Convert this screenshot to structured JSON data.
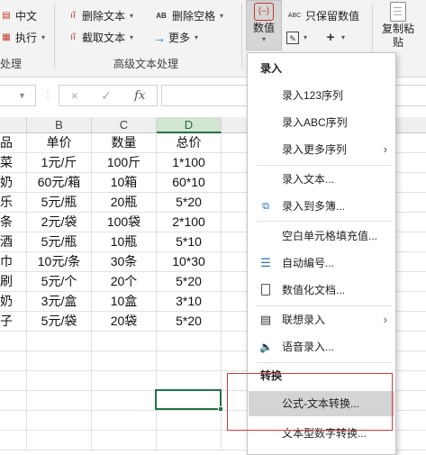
{
  "ribbon": {
    "row1": [
      {
        "label": "中文",
        "icon": "chinese-icon"
      },
      {
        "label": "删除文本",
        "icon": "delete-text-icon"
      },
      {
        "label": "删除空格",
        "icon": "delete-space-icon",
        "prefix": "AB"
      },
      {
        "label": "只保留数值",
        "icon": "keep-numbers-icon",
        "prefix": "ABC"
      }
    ],
    "row2": [
      {
        "label": "执行",
        "icon": "execute-icon"
      },
      {
        "label": "截取文本",
        "icon": "extract-text-icon"
      },
      {
        "label": "更多",
        "icon": "more-arrow-icon"
      }
    ],
    "row3_icons": [
      "edit-format-icon",
      "plus-icon"
    ],
    "numeric_button": {
      "label": "数值"
    },
    "copy_button": {
      "label_line1": "复制粘",
      "label_line2": "贴"
    },
    "groups": {
      "left": "处理",
      "advanced": "高级文本处理"
    }
  },
  "formula_bar": {
    "fx_label": "fx",
    "cancel_symbol": "×",
    "confirm_symbol": "✓",
    "value": ""
  },
  "grid": {
    "columns": [
      "B",
      "C",
      "D"
    ],
    "headers": {
      "a": "品",
      "b": "单价",
      "c": "数量",
      "d": "总价"
    },
    "rows": [
      {
        "a": "菜",
        "b": "1元/斤",
        "c": "100斤",
        "d": "1*100"
      },
      {
        "a": "奶",
        "b": "60元/箱",
        "c": "10箱",
        "d": "60*10"
      },
      {
        "a": "乐",
        "b": "5元/瓶",
        "c": "20瓶",
        "d": "5*20"
      },
      {
        "a": "条",
        "b": "2元/袋",
        "c": "100袋",
        "d": "2*100"
      },
      {
        "a": "酒",
        "b": "5元/瓶",
        "c": "10瓶",
        "d": "5*10"
      },
      {
        "a": "巾",
        "b": "10元/条",
        "c": "30条",
        "d": "10*30"
      },
      {
        "a": "刷",
        "b": "5元/个",
        "c": "20个",
        "d": "5*20"
      },
      {
        "a": "奶",
        "b": "3元/盒",
        "c": "10盒",
        "d": "3*10"
      },
      {
        "a": "子",
        "b": "5元/袋",
        "c": "20袋",
        "d": "5*20"
      }
    ]
  },
  "menu": {
    "section_input": "录入",
    "section_convert": "转换",
    "items": [
      {
        "label": "录入123序列",
        "icon": "",
        "arrow": ""
      },
      {
        "label": "录入ABC序列",
        "icon": "",
        "arrow": ""
      },
      {
        "label": "录入更多序列",
        "icon": "",
        "arrow": "›"
      },
      {
        "label": "录入文本...",
        "icon": "",
        "arrow": ""
      },
      {
        "label": "录入到多簿...",
        "icon": "copy-sheets-icon",
        "arrow": ""
      },
      {
        "label": "空白单元格填充值...",
        "icon": "",
        "arrow": ""
      },
      {
        "label": "自动编号...",
        "icon": "numbered-list-icon",
        "arrow": ""
      },
      {
        "label": "数值化文档...",
        "icon": "document-icon",
        "arrow": ""
      },
      {
        "label": "联想录入",
        "icon": "table-icon",
        "arrow": "›"
      },
      {
        "label": "语音录入...",
        "icon": "speaker-icon",
        "arrow": ""
      },
      {
        "label": "公式-文本转换...",
        "icon": "",
        "arrow": ""
      },
      {
        "label": "文本型数字转换...",
        "icon": "",
        "arrow": ""
      }
    ]
  },
  "colors": {
    "accent_green": "#217346",
    "highlight_box": "#d33a3a",
    "menu_hover": "#d4d4d4"
  }
}
